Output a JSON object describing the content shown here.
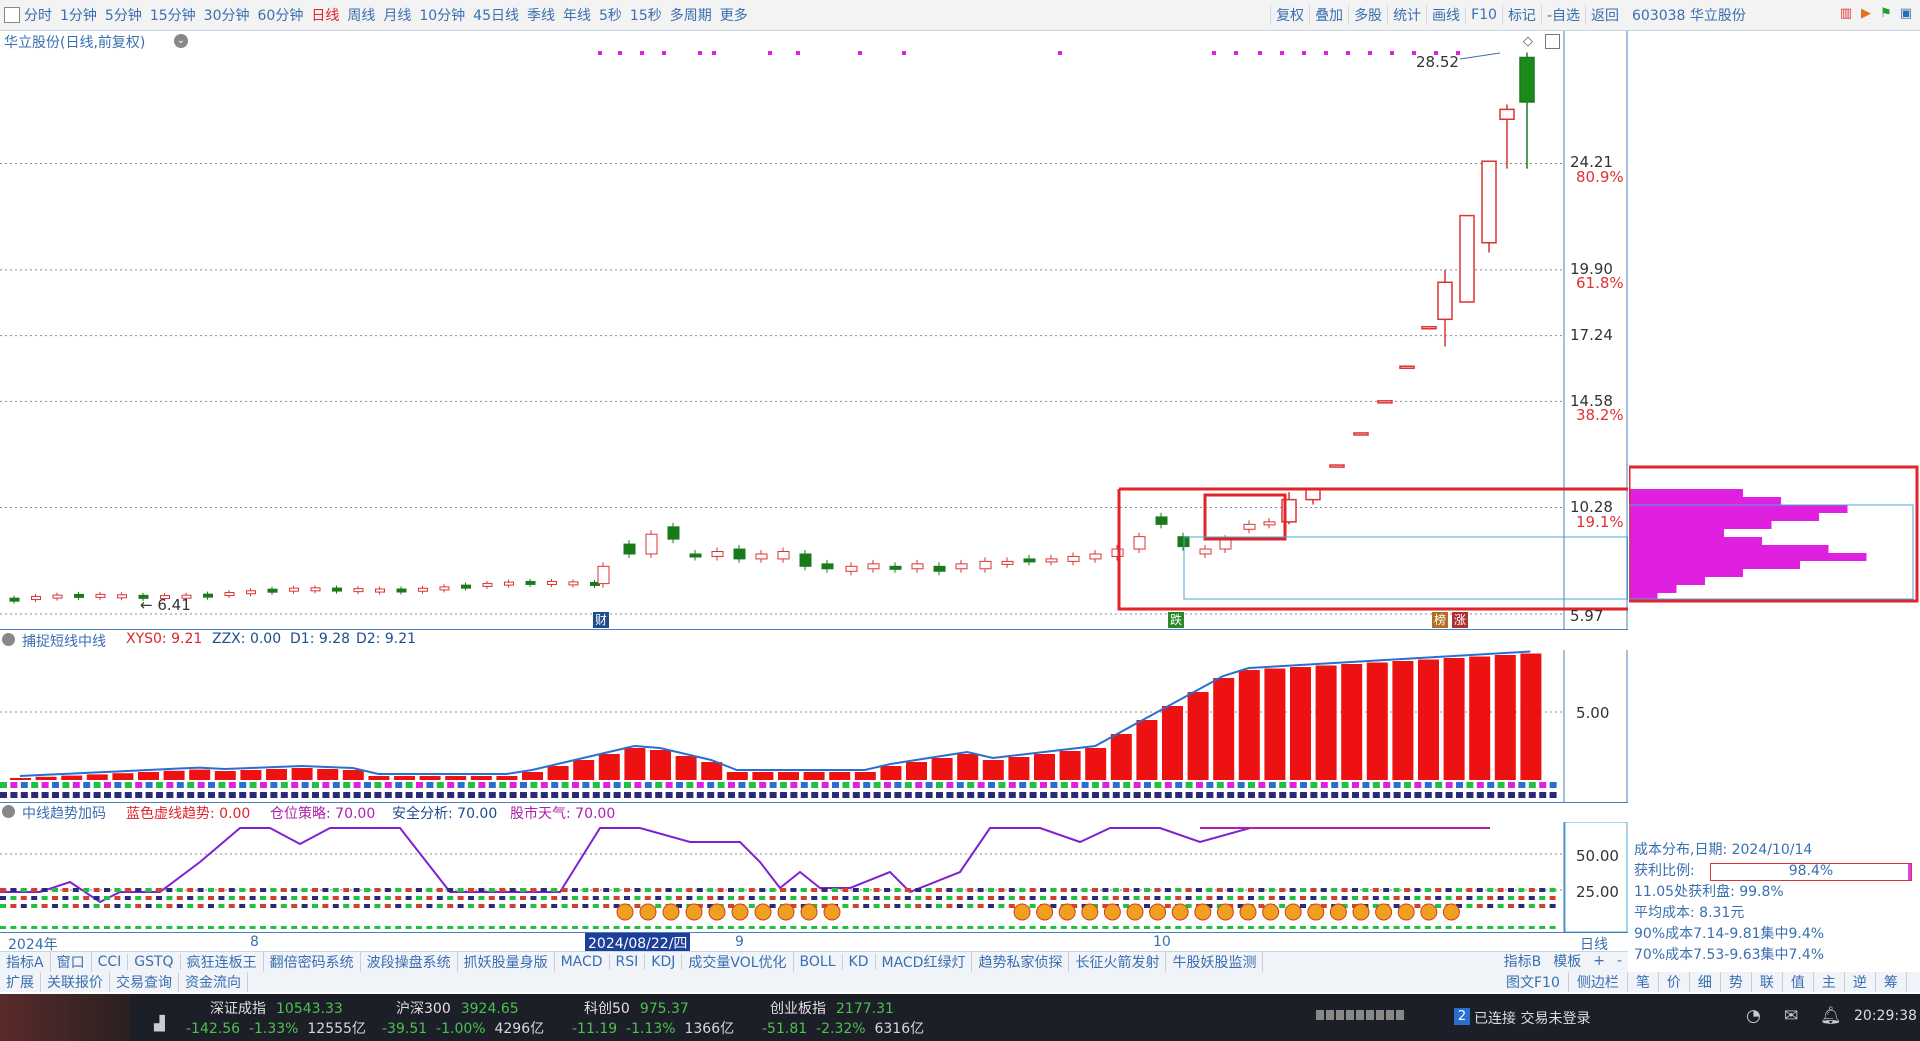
{
  "top_bar": {
    "periods": [
      "分时",
      "1分钟",
      "5分钟",
      "15分钟",
      "30分钟",
      "60分钟",
      "日线",
      "周线",
      "月线",
      "10分钟",
      "45日线",
      "季线",
      "年线",
      "5秒",
      "15秒",
      "多周期",
      "更多"
    ],
    "active_period": "日线",
    "tools": [
      "复权",
      "叠加",
      "多股",
      "统计",
      "画线",
      "F10",
      "标记",
      "-自选",
      "返回"
    ]
  },
  "info_head": {
    "code_name": "603038 华立股份"
  },
  "main_chart": {
    "title": "华立股份(日线,前复权)",
    "price_labels": [
      "28.52",
      "24.21",
      "19.90",
      "17.24",
      "14.58",
      "10.28",
      "5.97"
    ],
    "pct_labels": [
      "80.9%",
      "61.8%",
      "38.2%",
      "19.1%"
    ],
    "min_label": "6.41",
    "marker_cai": "财",
    "marker_die": "跌",
    "marker_bang": "榜",
    "marker_zhang": "涨"
  },
  "chart_data": {
    "type": "candlestick",
    "price_axis_ticks": [
      28.52,
      24.21,
      19.9,
      17.24,
      14.58,
      10.28,
      5.97
    ],
    "fib_levels": {
      "80.9%": 24.21,
      "61.8%": 19.9,
      "38.2%": 14.58,
      "19.1%": 10.28
    },
    "low_marker": 6.41,
    "high_marker": 28.52,
    "recent_candles": [
      {
        "o": 9.7,
        "c": 10.6,
        "h": 10.9,
        "l": 9.6
      },
      {
        "o": 10.6,
        "c": 11.0,
        "h": 11.0,
        "l": 10.4
      },
      {
        "o": 12.0,
        "c": 12.0,
        "h": 12.0,
        "l": 12.0
      },
      {
        "o": 13.3,
        "c": 13.3,
        "h": 13.3,
        "l": 13.3
      },
      {
        "o": 14.6,
        "c": 14.6,
        "h": 14.6,
        "l": 14.6
      },
      {
        "o": 16.0,
        "c": 16.0,
        "h": 16.0,
        "l": 16.0
      },
      {
        "o": 17.6,
        "c": 17.6,
        "h": 17.6,
        "l": 17.6
      },
      {
        "o": 17.9,
        "c": 19.4,
        "h": 19.9,
        "l": 16.8
      },
      {
        "o": 18.6,
        "c": 22.1,
        "h": 22.1,
        "l": 18.6
      },
      {
        "o": 21.0,
        "c": 24.3,
        "h": 24.3,
        "l": 20.6
      },
      {
        "o": 26.0,
        "c": 26.4,
        "h": 26.6,
        "l": 24.0
      },
      {
        "o": 28.5,
        "c": 26.7,
        "h": 28.7,
        "l": 24.0
      }
    ]
  },
  "ind1": {
    "title": "捕捉短线中线",
    "xys0": "XYS0: 9.21",
    "zzx": "ZZX: 0.00",
    "d1": "D1: 9.28",
    "d2": "D2: 9.21",
    "axis": "5.00"
  },
  "ind2": {
    "title": "中线趋势加码",
    "blue": "蓝色虚线趋势: 0.00",
    "pos": "仓位策略: 70.00",
    "safe": "安全分析: 70.00",
    "sky": "股市天气: 70.00",
    "axis50": "50.00",
    "axis25": "25.00"
  },
  "date_axis": {
    "year": "2024年",
    "m8": "8",
    "selected": "2024/08/22/四",
    "m9": "9",
    "m10": "10",
    "right": "日线"
  },
  "tab_row1": [
    "指标A",
    "窗口",
    "CCI",
    "GSTQ",
    "疯狂连板王",
    "翻倍密码系统",
    "波段操盘系统",
    "抓妖股量身版",
    "MACD",
    "RSI",
    "KDJ",
    "成交量VOL优化",
    "BOLL",
    "KD",
    "MACD红绿灯",
    "趋势私家侦探",
    "长征火箭发射",
    "牛股妖股监测"
  ],
  "tab_row1_right": [
    "指标B",
    "模板",
    "+",
    "-"
  ],
  "tab_row2": [
    "扩展",
    "关联报价",
    "交易查询",
    "资金流向"
  ],
  "side_tabs": [
    "图文F10",
    "侧边栏",
    "笔",
    "价",
    "细",
    "势",
    "联",
    "值",
    "主",
    "逆",
    "筹"
  ],
  "cost_info": {
    "date": "成本分布,日期: 2024/10/14",
    "profit_label": "获利比例:",
    "profit_value": "98.4%",
    "line1": "11.05处获利盘: 99.8%",
    "line2": "平均成本: 8.31元",
    "line3": "90%成本7.14-9.81集中9.4%",
    "line4": "70%成本7.53-9.63集中7.4%"
  },
  "status": {
    "szcz": "深证成指",
    "szcz_v": "10543.33",
    "szcz_c": "-142.56",
    "szcz_p": "-1.33%",
    "szcz_a": "12555亿",
    "hs300": "沪深300",
    "hs300_v": "3924.65",
    "hs300_c": "-39.51",
    "hs300_p": "-1.00%",
    "hs300_a": "4296亿",
    "kc50": "科创50",
    "kc50_v": "975.37",
    "kc50_c": "-11.19",
    "kc50_p": "-1.13%",
    "kc50_a": "1366亿",
    "cyb": "创业板指",
    "cyb_v": "2177.31",
    "cyb_c": "-51.81",
    "cyb_p": "-2.32%",
    "cyb_a": "6316亿",
    "conn": "已连接 交易未登录",
    "conn_num": "2",
    "time": "20:29:38"
  }
}
